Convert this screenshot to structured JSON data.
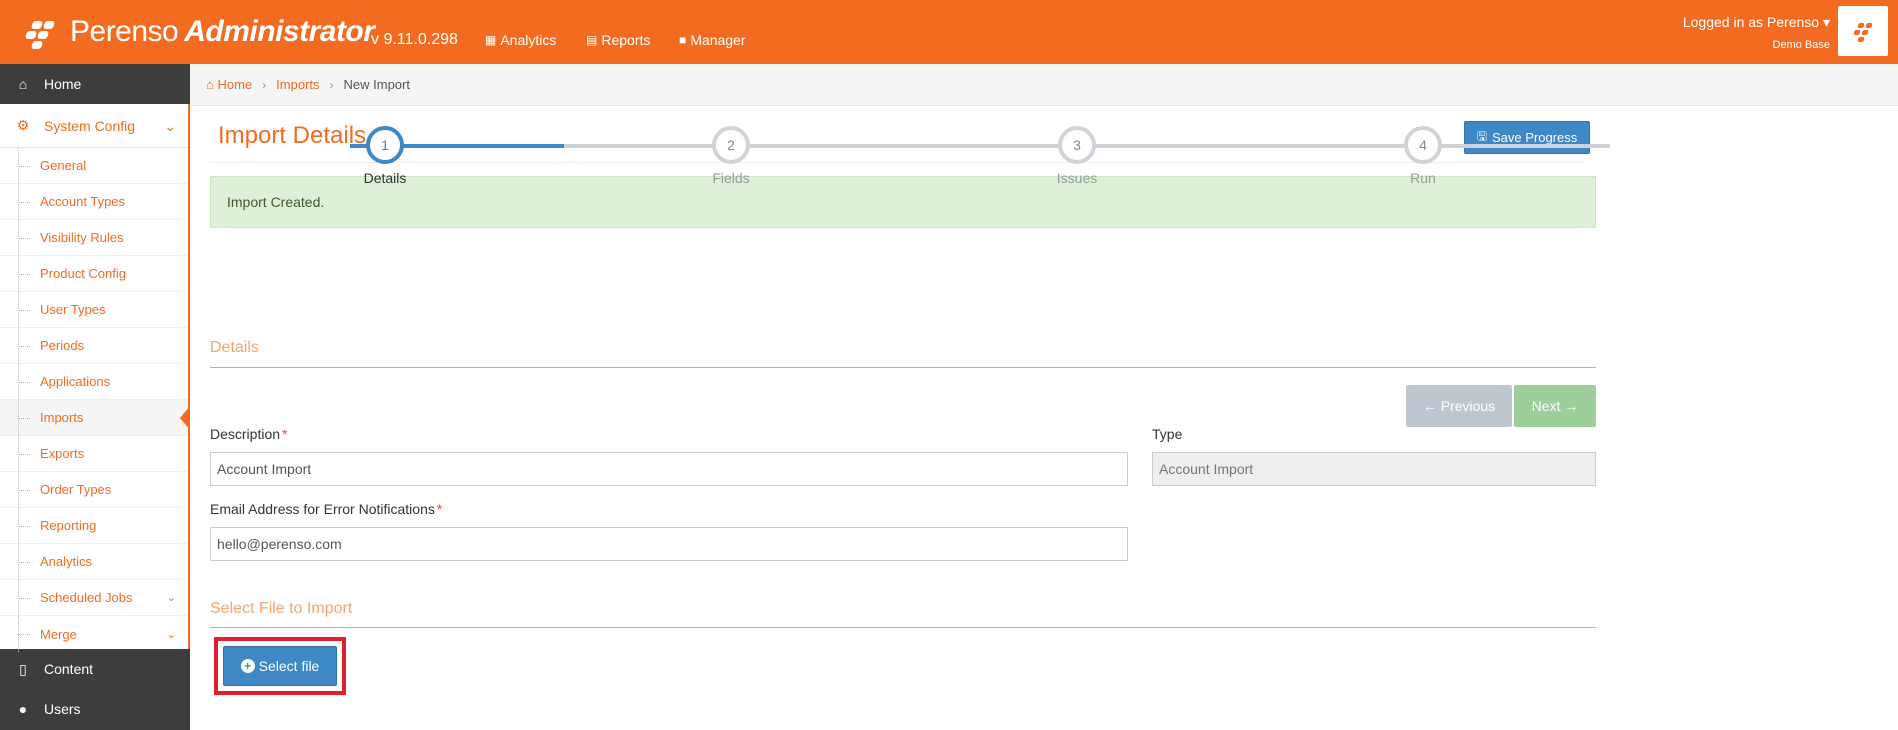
{
  "header": {
    "brand_first": "Perenso",
    "brand_second": "Administrator",
    "version": "v 9.11.0.298",
    "nav": [
      {
        "label": "Analytics",
        "icon": "chart-icon"
      },
      {
        "label": "Reports",
        "icon": "table-icon"
      },
      {
        "label": "Manager",
        "icon": "briefcase-icon"
      }
    ],
    "user_label": "Logged in as Perenso",
    "user_base": "Demo Base"
  },
  "sidebar": {
    "home": "Home",
    "system_config": "System Config",
    "items": [
      {
        "label": "General"
      },
      {
        "label": "Account Types"
      },
      {
        "label": "Visibility Rules"
      },
      {
        "label": "Product Config"
      },
      {
        "label": "User Types"
      },
      {
        "label": "Periods"
      },
      {
        "label": "Applications"
      },
      {
        "label": "Imports"
      },
      {
        "label": "Exports"
      },
      {
        "label": "Order Types"
      },
      {
        "label": "Reporting"
      },
      {
        "label": "Analytics"
      },
      {
        "label": "Scheduled Jobs"
      },
      {
        "label": "Merge"
      }
    ],
    "active_item": "Imports",
    "content": "Content",
    "users": "Users"
  },
  "breadcrumb": {
    "home": "Home",
    "imports": "Imports",
    "current": "New Import"
  },
  "page": {
    "title": "Import Details",
    "save_label": "Save Progress",
    "alert": "Import Created."
  },
  "stepper": {
    "active_step": 1,
    "progress": 0.5,
    "steps": [
      {
        "num": "1",
        "label": "Details"
      },
      {
        "num": "2",
        "label": "Fields"
      },
      {
        "num": "3",
        "label": "Issues"
      },
      {
        "num": "4",
        "label": "Run"
      }
    ]
  },
  "details": {
    "section_title": "Details",
    "previous_label": "Previous",
    "next_label": "Next",
    "description_label": "Description",
    "description_value": "Account Import",
    "type_label": "Type",
    "type_value": "Account Import",
    "email_label": "Email Address for Error Notifications",
    "email_value": "hello@perenso.com",
    "required_mark": "*"
  },
  "file": {
    "section_title": "Select File to Import",
    "select_label": "Select file"
  },
  "colors": {
    "brand_orange": "#f26b21",
    "primary_blue": "#3d88c5",
    "success_bg": "#dff0d8",
    "highlight_red": "#e0202e"
  }
}
